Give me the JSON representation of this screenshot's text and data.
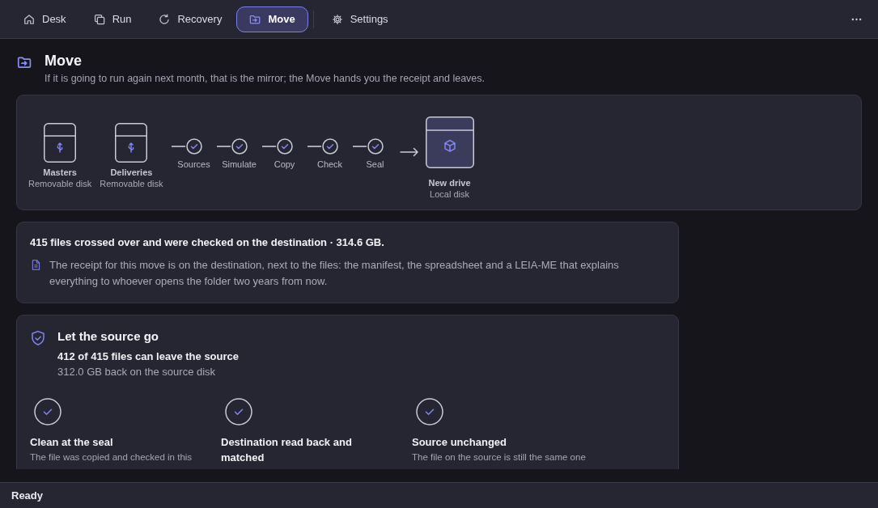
{
  "nav": {
    "tabs": [
      {
        "label": "Desk",
        "selected": false
      },
      {
        "label": "Run",
        "selected": false
      },
      {
        "label": "Recovery",
        "selected": false
      },
      {
        "label": "Move",
        "selected": true
      }
    ],
    "utility_tabs": [
      {
        "label": "Settings",
        "selected": false
      }
    ]
  },
  "page": {
    "title": "Move",
    "subtitle": "If it is going to run again next month, that is the mirror; the Move hands you the receipt and leaves."
  },
  "diagram": {
    "sources": [
      {
        "name": "Masters",
        "type": "Removable disk"
      },
      {
        "name": "Deliveries",
        "type": "Removable disk"
      }
    ],
    "steps": [
      {
        "label": "Sources",
        "done": true
      },
      {
        "label": "Simulate",
        "done": true
      },
      {
        "label": "Copy",
        "done": true
      },
      {
        "label": "Check",
        "done": true
      },
      {
        "label": "Seal",
        "done": true
      }
    ],
    "destination": {
      "name": "New drive",
      "type": "Local disk"
    }
  },
  "summary": {
    "headline": "415 files crossed over and were checked on the destination · 314.6 GB.",
    "note": "The receipt for this move is on the destination, next to the files: the manifest, the spreadsheet and a LEIA-ME that explains everything to whoever opens the folder two years from now."
  },
  "release": {
    "title": "Let the source go",
    "count": "412 of 415 files can leave the source",
    "space": "312.0 GB back on the source disk",
    "criteria": [
      {
        "title": "Clean at the seal",
        "description": "The file was copied and checked in this",
        "met": true
      },
      {
        "title": "Destination read back and matched",
        "met": true
      },
      {
        "title": "Source unchanged",
        "description": "The file on the source is still the same one",
        "met": true
      }
    ]
  },
  "status_bar": {
    "text": "Ready"
  }
}
